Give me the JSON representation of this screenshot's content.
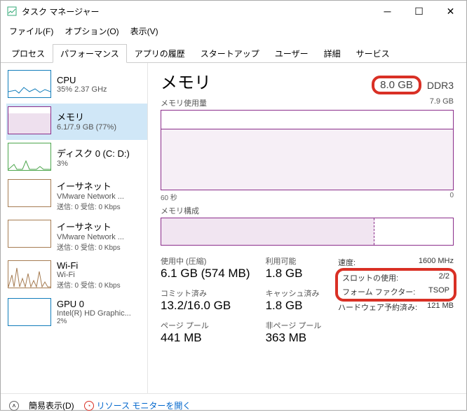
{
  "window": {
    "title": "タスク マネージャー"
  },
  "menu": {
    "file": "ファイル(F)",
    "options": "オプション(O)",
    "view": "表示(V)"
  },
  "tabs": {
    "items": [
      "プロセス",
      "パフォーマンス",
      "アプリの履歴",
      "スタートアップ",
      "ユーザー",
      "詳細",
      "サービス"
    ],
    "active": 1
  },
  "sidebar": [
    {
      "title": "CPU",
      "sub": "35%  2.37 GHz",
      "type": "cpu"
    },
    {
      "title": "メモリ",
      "sub": "6.1/7.9 GB (77%)",
      "type": "mem",
      "active": true
    },
    {
      "title": "ディスク 0 (C: D:)",
      "sub": "3%",
      "type": "disk"
    },
    {
      "title": "イーサネット",
      "sub": "VMware Network ...",
      "sub2": "送信: 0 受信: 0 Kbps",
      "type": "net"
    },
    {
      "title": "イーサネット",
      "sub": "VMware Network ...",
      "sub2": "送信: 0 受信: 0 Kbps",
      "type": "net"
    },
    {
      "title": "Wi-Fi",
      "sub": "Wi-Fi",
      "sub2": "送信: 0 受信: 0 Kbps",
      "type": "net"
    },
    {
      "title": "GPU 0",
      "sub": "Intel(R) HD Graphic...",
      "sub2": "2%",
      "type": "gpu"
    }
  ],
  "main": {
    "title": "メモリ",
    "total": "8.0 GB",
    "memtype": "DDR3",
    "usage_label": "メモリ使用量",
    "usage_max": "7.9 GB",
    "axis_left": "60 秒",
    "axis_right": "0",
    "comp_label": "メモリ構成",
    "stats": {
      "in_use_label": "使用中 (圧縮)",
      "in_use_value": "6.1 GB (574 MB)",
      "commit_label": "コミット済み",
      "commit_value": "13.2/16.0 GB",
      "paged_label": "ページ プール",
      "paged_value": "441 MB",
      "avail_label": "利用可能",
      "avail_value": "1.8 GB",
      "cached_label": "キャッシュ済み",
      "cached_value": "1.8 GB",
      "nonpaged_label": "非ページ プール",
      "nonpaged_value": "363 MB"
    },
    "right": {
      "speed_label": "速度:",
      "speed_value": "1600 MHz",
      "slots_label": "スロットの使用:",
      "slots_value": "2/2",
      "form_label": "フォーム ファクター:",
      "form_value": "TSOP",
      "hw_label": "ハードウェア予約済み:",
      "hw_value": "121 MB"
    }
  },
  "footer": {
    "simple": "簡易表示(D)",
    "resmon": "リソース モニターを開く"
  },
  "chart_data": {
    "type": "line",
    "title": "メモリ使用量",
    "xlabel": "60 秒",
    "ylabel": "",
    "ylim": [
      0,
      7.9
    ],
    "x": [
      60,
      55,
      50,
      45,
      40,
      35,
      30,
      25,
      20,
      15,
      10,
      5,
      0
    ],
    "series": [
      {
        "name": "使用中",
        "values": [
          6.1,
          6.1,
          6.1,
          6.1,
          6.1,
          6.1,
          6.15,
          6.1,
          6.1,
          6.1,
          6.1,
          6.1,
          6.1
        ]
      }
    ]
  }
}
